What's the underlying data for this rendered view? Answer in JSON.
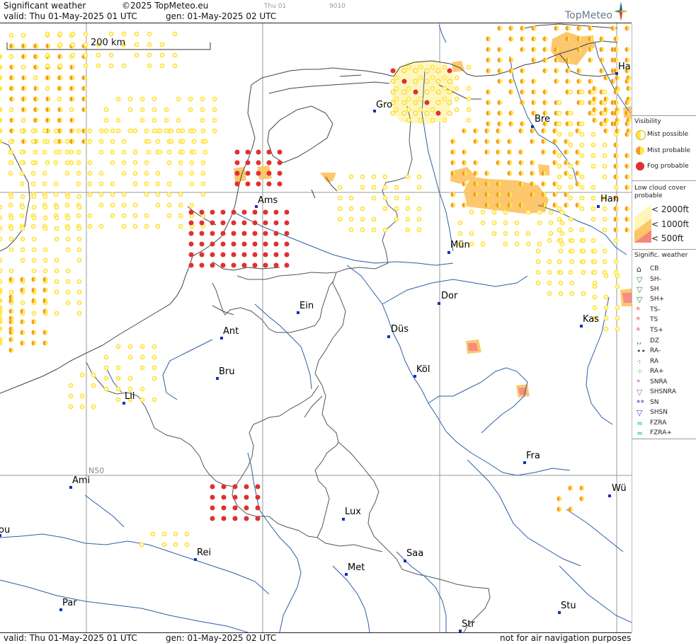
{
  "header": {
    "title": "Significant weather",
    "copyright": "©2025 TopMeteo.eu",
    "day_tab": "Thu 01",
    "code": "9010",
    "valid": "valid:  Thu   01-May-2025  01 UTC",
    "gen": "gen: 01-May-2025 02 UTC"
  },
  "footer": {
    "valid": "valid:  Thu   01-May-2025  01 UTC",
    "gen": "gen: 01-May-2025 02 UTC",
    "disclaimer": "not for air navigation purposes"
  },
  "logo": {
    "text": "TopMeteo"
  },
  "map": {
    "scale_label": "200 km",
    "lat_label": "N50",
    "cities": [
      {
        "name": "Gro"
      },
      {
        "name": "Bre"
      },
      {
        "name": "Ams"
      },
      {
        "name": "Han"
      },
      {
        "name": "Mün"
      },
      {
        "name": "Dor"
      },
      {
        "name": "Ein"
      },
      {
        "name": "Ant"
      },
      {
        "name": "Düs"
      },
      {
        "name": "Kas"
      },
      {
        "name": "Bru"
      },
      {
        "name": "Köl"
      },
      {
        "name": "Lil"
      },
      {
        "name": "Fra"
      },
      {
        "name": "Ami"
      },
      {
        "name": "Lux"
      },
      {
        "name": "Wü"
      },
      {
        "name": "Rei"
      },
      {
        "name": "Saa"
      },
      {
        "name": "Met"
      },
      {
        "name": "Stu"
      },
      {
        "name": "Par"
      },
      {
        "name": "Str"
      },
      {
        "name": "Ha"
      },
      {
        "name": "ou"
      }
    ]
  },
  "legend": {
    "visibility": {
      "title": "Visibility",
      "items": [
        {
          "label": "Mist possible",
          "icon": "mist-possible-icon",
          "color": "#ffe64d"
        },
        {
          "label": "Mist probable",
          "icon": "mist-probable-icon",
          "color": "#f39a2a"
        },
        {
          "label": "Fog probable",
          "icon": "fog-probable-icon",
          "color": "#e03030"
        }
      ]
    },
    "low_cloud": {
      "title": "Low cloud cover probable",
      "items": [
        {
          "label": "< 2000ft",
          "color": "#fff6b8"
        },
        {
          "label": "< 1000ft",
          "color": "#fcc566"
        },
        {
          "label": "<   500ft",
          "color": "#f7867a"
        }
      ]
    },
    "signific": {
      "title": "Signific. weather",
      "items": [
        {
          "label": "CB",
          "icon": "cb-icon"
        },
        {
          "label": "SH-",
          "icon": "shower-light-icon"
        },
        {
          "label": "SH",
          "icon": "shower-icon"
        },
        {
          "label": "SH+",
          "icon": "shower-heavy-icon"
        },
        {
          "label": "TS-",
          "icon": "thunderstorm-light-icon"
        },
        {
          "label": "TS",
          "icon": "thunderstorm-icon"
        },
        {
          "label": "TS+",
          "icon": "thunderstorm-heavy-icon"
        },
        {
          "label": "DZ",
          "icon": "drizzle-icon"
        },
        {
          "label": "RA-",
          "icon": "rain-light-icon"
        },
        {
          "label": "RA",
          "icon": "rain-icon"
        },
        {
          "label": "RA+",
          "icon": "rain-heavy-icon"
        },
        {
          "label": "SNRA",
          "icon": "snow-rain-icon"
        },
        {
          "label": "SHSNRA",
          "icon": "snow-rain-shower-icon"
        },
        {
          "label": "SN",
          "icon": "snow-icon"
        },
        {
          "label": "SHSN",
          "icon": "snow-shower-icon"
        },
        {
          "label": "FZRA",
          "icon": "freezing-rain-icon"
        },
        {
          "label": "FZRA+",
          "icon": "freezing-rain-heavy-icon"
        }
      ]
    }
  },
  "colors": {
    "mist_possible": "#ffe64d",
    "mist_probable": "#f39a2a",
    "fog": "#e03030",
    "cloud_2000": "#fff6b8",
    "cloud_1000": "#fcc566",
    "cloud_500": "#f7867a",
    "river": "#2b5fa8",
    "border": "#555555",
    "city": "#1030c0"
  }
}
